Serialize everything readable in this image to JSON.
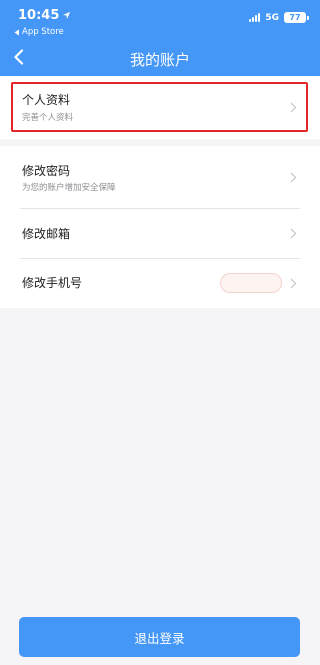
{
  "status_bar": {
    "time": "10:45",
    "back_app": "App Store",
    "network": "5G",
    "battery": "77"
  },
  "header": {
    "title": "我的账户"
  },
  "menu": {
    "profile": {
      "title": "个人资料",
      "subtitle": "完善个人资料"
    },
    "password": {
      "title": "修改密码",
      "subtitle": "为您的账户增加安全保障"
    },
    "email": {
      "title": "修改邮箱"
    },
    "phone": {
      "title": "修改手机号"
    }
  },
  "logout": {
    "label": "退出登录"
  },
  "colors": {
    "accent": "#4597f7",
    "highlight_border": "#e4262b",
    "background": "#f5f5f7"
  }
}
